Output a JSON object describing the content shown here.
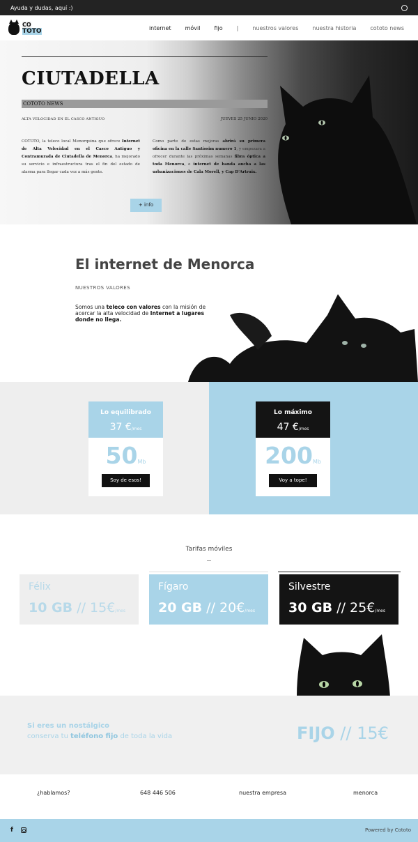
{
  "topbar": {
    "help": "Ayuda y dudas, aquí :)",
    "whatsapp_icon": "whatsapp-icon"
  },
  "logo": {
    "line1": "CO",
    "line2": "TOTO"
  },
  "nav": {
    "internet": "internet",
    "movil": "móvil",
    "fijo": "fijo",
    "separator": "|",
    "valores": "nuestros valores",
    "historia": "nuestra historia",
    "news": "cototo news"
  },
  "hero": {
    "title": "CIUTADELLA",
    "band": "COTOTO NEWS",
    "subtitle": "ALTA VELOCIDAD EN EL CASCO ANTIGUO",
    "date": "JUEVES 25 JUNIO 2020",
    "col1_a": "COTOTO, la teleco local Menorquina que ofrece ",
    "col1_b": "Internet de Alta Velocidad en el Casco Antiguo y Contramurada de Ciutadella de Menorca",
    "col1_c": ", ha mejorado su servicio e infraestructura tras el fin del estado de alarma para llegar cada vez a más gente.",
    "col2_a": "Como parte de estas mejoras ",
    "col2_b": "abrirá su primera oficina en la calle Santíssim numero 1",
    "col2_c": ", y empezara a ofrecer durante las próximas semanas ",
    "col2_d": "fibra óptica a toda Menorca",
    "col2_e": ", e ",
    "col2_f": "internet de banda ancha a las urbanizaciones de Cala Morell, y Cap D'Artruix.",
    "button": "+ info"
  },
  "internet": {
    "title": "El internet de Menorca",
    "values_label": "NUESTROS VALORES",
    "desc_a": "Somos una ",
    "desc_b": "teleco con valores",
    "desc_c": " con la misión de acercar la alta velocidad de ",
    "desc_d": "Internet a lugares donde no llega."
  },
  "plans": [
    {
      "name": "Lo equilibrado",
      "price": "37 €",
      "period": "/mes",
      "speed": "50",
      "unit": "Mb",
      "button": "Soy de esos!"
    },
    {
      "name": "Lo máximo",
      "price": "47 €",
      "period": "/mes",
      "speed": "200",
      "unit": "Mb",
      "button": "Voy a tope!"
    }
  ],
  "mobile": {
    "title": "Tarifas móviles",
    "tariffs": [
      {
        "name": "Félix",
        "data": "10 GB",
        "sep": " // ",
        "price": "15€",
        "period": "/mes"
      },
      {
        "name": "Fígaro",
        "data": "20 GB",
        "sep": " // ",
        "price": "20€",
        "period": "/mes"
      },
      {
        "name": "Silvestre",
        "data": "30 GB",
        "sep": " // ",
        "price": "25€",
        "period": "/mes"
      }
    ]
  },
  "fijo": {
    "line1": "Si eres un nostálgico",
    "line2_a": "conserva tu ",
    "line2_b": "teléfono fijo",
    "line2_c": " de toda la vida",
    "price_label": "FIJO",
    "price_sep": " // ",
    "price": "15€"
  },
  "contact": {
    "talk": "¿hablamos?",
    "phone": "648 446 506",
    "company": "nuestra empresa",
    "place": "menorca"
  },
  "footer": {
    "facebook": "f",
    "powered": "Powered by Cototo"
  },
  "colors": {
    "accent": "#a9d4e8",
    "dark": "#141414",
    "light_gray": "#eeeeee"
  }
}
